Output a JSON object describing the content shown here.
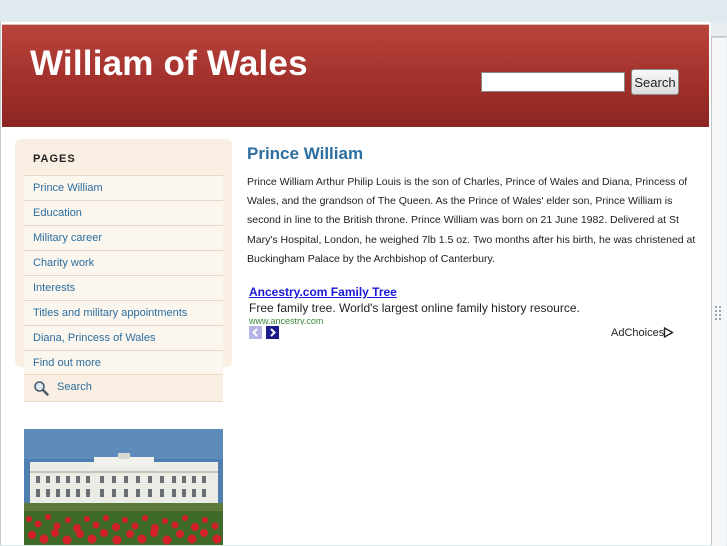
{
  "header": {
    "site_title": "William of Wales",
    "search_button": "Search",
    "search_value": ""
  },
  "sidebar": {
    "heading": "PAGES",
    "items": [
      {
        "label": "Prince William"
      },
      {
        "label": "Education"
      },
      {
        "label": "Military career"
      },
      {
        "label": "Charity work"
      },
      {
        "label": "Interests"
      },
      {
        "label": "Titles and military appointments"
      },
      {
        "label": "Diana, Princess of Wales"
      },
      {
        "label": "Find out more"
      }
    ],
    "search_label": "Search"
  },
  "main": {
    "title": "Prince William",
    "body": "Prince William Arthur Philip Louis is the son of Charles, Prince of Wales and Diana, Princess of Wales, and the grandson of The Queen.  As the Prince of Wales' elder son, Prince William is second in line to the British throne.  Prince William was born on 21 June 1982.  Delivered at St Mary's Hospital, London, he weighed 7lb 1.5 oz.  Two months after his birth, he was christened at Buckingham Palace by the Archbishop of Canterbury."
  },
  "ad": {
    "title": "Ancestry.com Family Tree",
    "description": "Free family tree. World's largest online family history resource.",
    "url": "www.ancestry.com",
    "adchoices": "AdChoices"
  },
  "colors": {
    "header": "#a2302b",
    "link": "#2c6e9f",
    "sidebar_bg": "#f8efe2",
    "ad_link": "#1a1ad6"
  }
}
